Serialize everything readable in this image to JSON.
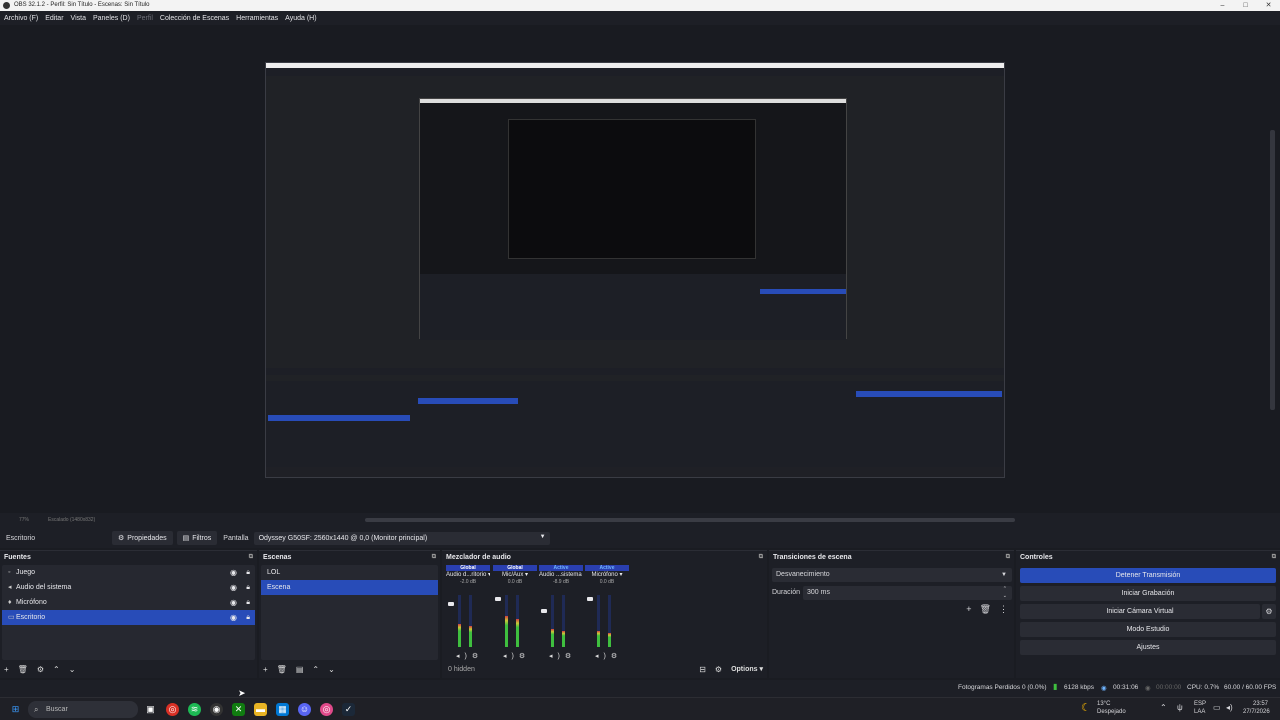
{
  "window": {
    "title": "OBS 32.1.2 - Perfil: Sin Título - Escenas: Sin Título",
    "controls": [
      "–",
      "□",
      "✕"
    ]
  },
  "menu": [
    {
      "label": "Archivo (F)",
      "enabled": true
    },
    {
      "label": "Editar",
      "enabled": true
    },
    {
      "label": "Vista",
      "enabled": true
    },
    {
      "label": "Paneles (D)",
      "enabled": true
    },
    {
      "label": "Perfil",
      "enabled": false
    },
    {
      "label": "Colección de Escenas",
      "enabled": true
    },
    {
      "label": "Herramientas",
      "enabled": true
    },
    {
      "label": "Ayuda (H)",
      "enabled": true
    }
  ],
  "scale": {
    "zoom": "77%",
    "scaled": "Escalado (1480x832)"
  },
  "sourcebar": {
    "selected_source": "Escritorio",
    "properties": "Propiedades",
    "filters": "Filtros",
    "screen_label": "Pantalla",
    "screen_value": "Odyssey G50SF: 2560x1440 @ 0,0 (Monitor principal)"
  },
  "sources": {
    "title": "Fuentes",
    "items": [
      {
        "label": "Juego",
        "icon": "gamepad-icon",
        "selected": false
      },
      {
        "label": "Audio del sistema",
        "icon": "speaker-icon",
        "selected": false
      },
      {
        "label": "Micrófono",
        "icon": "microphone-icon",
        "selected": false
      },
      {
        "label": "Escritorio",
        "icon": "monitor-icon",
        "selected": true
      }
    ]
  },
  "scenes": {
    "title": "Escenas",
    "items": [
      {
        "label": "LOL",
        "selected": false
      },
      {
        "label": "Escena",
        "selected": true
      }
    ]
  },
  "mixer": {
    "title": "Mezclador de audio",
    "hidden": "0 hidden",
    "options": "Options",
    "channels": [
      {
        "header": "Global",
        "name": "Audio d...ritorio",
        "db": "-2.0 dB",
        "level": 0.45,
        "fader": 0.85
      },
      {
        "header": "Global",
        "name": "Mic/Aux",
        "db": "0.0 dB",
        "level": 0.6,
        "fader": 0.95
      },
      {
        "header": "Active",
        "name": "Audio ...sistema",
        "db": "-8.9 dB",
        "level": 0.35,
        "fader": 0.7
      },
      {
        "header": "Active",
        "name": "Micrófono",
        "db": "0.0 dB",
        "level": 0.3,
        "fader": 0.95
      }
    ]
  },
  "transitions": {
    "title": "Transiciones de escena",
    "selected": "Desvanecimiento",
    "duration_label": "Duración",
    "duration_value": "300 ms"
  },
  "controls": {
    "title": "Controles",
    "stop_stream": "Detener Transmisión",
    "start_record": "Iniciar Grabación",
    "virtual_cam": "Iniciar Cámara Virtual",
    "studio_mode": "Modo Estudio",
    "settings": "Ajustes"
  },
  "status": {
    "dropped": "Fotogramas Perdidos 0 (0.0%)",
    "bitrate": "6128 kbps",
    "stream_time": "00:31:06",
    "rec_time": "00:00:00",
    "cpu": "CPU: 0.7%",
    "fps": "60.00 / 60.00 FPS"
  },
  "taskbar": {
    "search": "Buscar",
    "weather_temp": "13°C",
    "weather_text": "Despejado",
    "lang_top": "ESP",
    "lang_bottom": "LAA",
    "time": "23:57",
    "date": "27/7/2026"
  },
  "colors": {
    "accent": "#284cb8",
    "panel": "#1d1f26",
    "meter_green": "#3fbf3f",
    "meter_red": "#d23b3b"
  }
}
